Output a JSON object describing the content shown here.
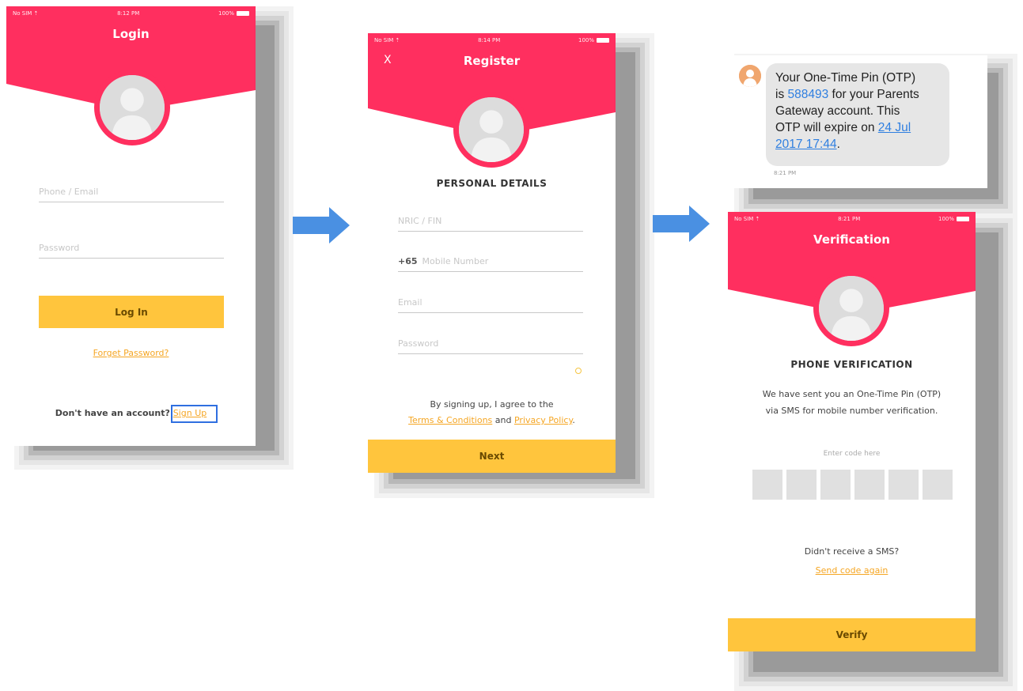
{
  "colors": {
    "header": "#ff2f5f",
    "accent": "#ffc53d",
    "link": "#f5a623",
    "arrow": "#4a90e2",
    "sms_link": "#2f7fe0"
  },
  "status_bar": {
    "login": {
      "carrier": "No SIM ⇡",
      "time": "8:12 PM",
      "battery": "100%"
    },
    "register": {
      "carrier": "No SIM ⇡",
      "time": "8:14 PM",
      "battery": "100%"
    },
    "verification": {
      "carrier": "No SIM ⇡",
      "time": "8:21 PM",
      "battery": "100%"
    }
  },
  "login": {
    "title": "Login",
    "phone_placeholder": "Phone / Email",
    "password_placeholder": "Password",
    "login_button": "Log In",
    "forgot_password": "Forget Password?",
    "no_account_text": "Don't have an account?",
    "sign_up_link": "Sign Up"
  },
  "register": {
    "close_label": "X",
    "title": "Register",
    "section_title": "PERSONAL DETAILS",
    "nric_placeholder": "NRIC / FIN",
    "mobile_prefix": "+65",
    "mobile_placeholder": "Mobile Number",
    "email_placeholder": "Email",
    "password_placeholder": "Password",
    "agree_text": "By signing up, I agree to the",
    "terms_link": "Terms & Conditions",
    "and_text": "and",
    "privacy_link": "Privacy Policy",
    "period": ".",
    "next_button": "Next"
  },
  "sms": {
    "line1": "Your One-Time Pin (OTP)",
    "line2_pre": "is ",
    "otp_code": "588493",
    "line2_post": " for your Parents",
    "line3": "Gateway account. This",
    "line4_pre": "OTP will expire on ",
    "expiry_date": "24 Jul",
    "expiry_time": "2017 17:44",
    "line5_post": ".",
    "time": "8:21 PM"
  },
  "verification": {
    "title": "Verification",
    "section_title": "PHONE VERIFICATION",
    "message_line1": "We have sent you an One-Time Pin (OTP)",
    "message_line2": "via SMS for mobile number verification.",
    "code_label": "Enter code here",
    "didnt_receive": "Didn't receive a SMS?",
    "send_again": "Send code again",
    "verify_button": "Verify"
  },
  "icons": [
    "user-avatar-icon",
    "arrow-right-icon",
    "close-icon",
    "battery-icon",
    "sms-sender-avatar-icon"
  ]
}
